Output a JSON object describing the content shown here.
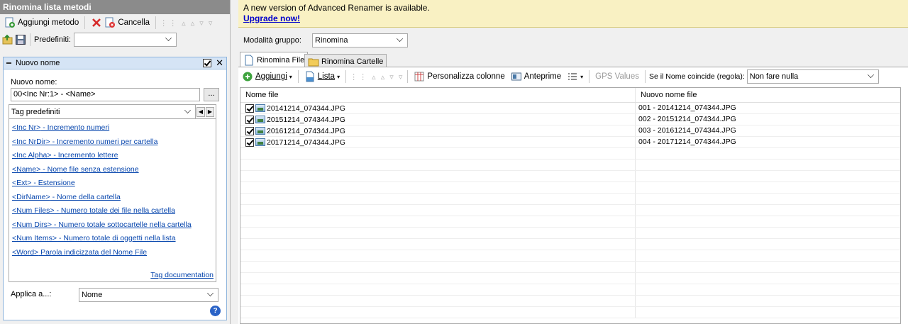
{
  "left_panel": {
    "title": "Rinomina lista metodi",
    "toolbar": {
      "add_method_label": "Aggiungi metodo",
      "delete_label": "Cancella"
    },
    "presets_label": "Predefiniti:",
    "presets_value": "",
    "method": {
      "title": "Nuovo nome",
      "new_name_label": "Nuovo nome:",
      "new_name_value": "00<Inc Nr:1> - <Name>",
      "browse_label": "...",
      "tags_combo": "Tag predefiniti",
      "tags": [
        {
          "tag": "<Inc Nr>",
          "desc": " - Incremento numeri"
        },
        {
          "tag": "<Inc NrDir>",
          "desc": " - Incremento numeri per cartella"
        },
        {
          "tag": "<Inc Alpha>",
          "desc": " - Incremento lettere"
        },
        {
          "tag": "<Name>",
          "desc": " - Nome file senza estensione"
        },
        {
          "tag": "<Ext>",
          "desc": " - Estensione"
        },
        {
          "tag": "<DirName>",
          "desc": " - Nome della cartella"
        },
        {
          "tag": "<Num Files>",
          "desc": " - Numero totale dei file nella cartella"
        },
        {
          "tag": "<Num Dirs>",
          "desc": " - Numero totale sottocartelle nella cartella"
        },
        {
          "tag": "<Num Items>",
          "desc": " - Numero totale di oggetti nella lista"
        },
        {
          "tag": "<Word>",
          "desc": " Parola indicizzata del Nome File"
        }
      ],
      "tag_doc_link": "Tag documentation",
      "apply_to_label": "Applica a...:",
      "apply_to_value": "Nome",
      "help_glyph": "?"
    }
  },
  "banner": {
    "message": "A new version of Advanced Renamer is available.",
    "link": "Upgrade now!"
  },
  "group_mode": {
    "label": "Modalità gruppo:",
    "value": "Rinomina"
  },
  "tabs": [
    {
      "label": "Rinomina File",
      "active": true
    },
    {
      "label": "Rinomina Cartelle",
      "active": false
    }
  ],
  "grid_toolbar": {
    "add_label": "Aggiungi",
    "list_label": "Lista",
    "customize_columns_label": "Personalizza colonne",
    "preview_label": "Anteprime",
    "gps_label": "GPS Values",
    "collision_label": "Se il Nome coincide (regola):",
    "collision_value": "Non fare nulla"
  },
  "grid": {
    "columns": [
      "Nome file",
      "Nuovo nome file"
    ],
    "rows": [
      {
        "checked": true,
        "filename": "20141214_074344.JPG",
        "new_name": "001 - 20141214_074344.JPG"
      },
      {
        "checked": true,
        "filename": "20151214_074344.JPG",
        "new_name": "002 - 20151214_074344.JPG"
      },
      {
        "checked": true,
        "filename": "20161214_074344.JPG",
        "new_name": "003 - 20161214_074344.JPG"
      },
      {
        "checked": true,
        "filename": "20171214_074344.JPG",
        "new_name": "004 - 20171214_074344.JPG"
      }
    ]
  }
}
